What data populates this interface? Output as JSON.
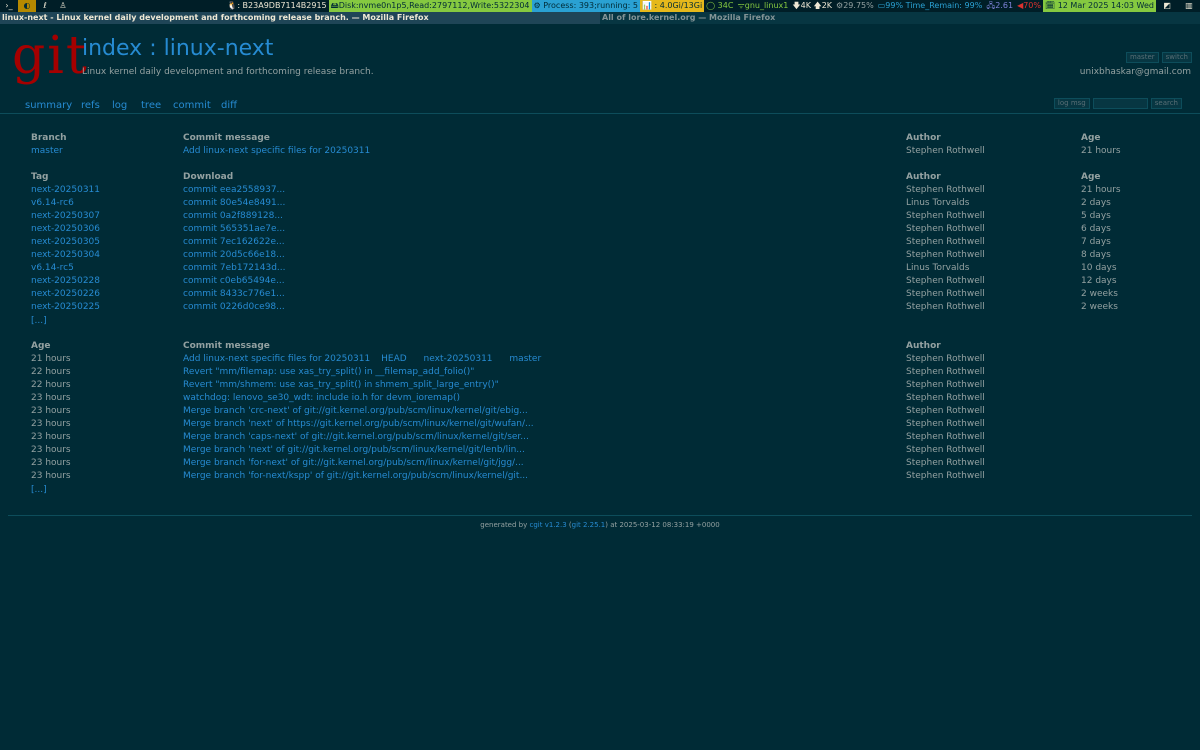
{
  "statusbar": {
    "workspaces": [
      "›_",
      "◐",
      "ℓ",
      "♙"
    ],
    "host": "🐧: B23A9DB7114B2915",
    "disk": "🖴Disk:nvme0n1p5,Read:2797112,Write:5322304",
    "process": "⚙ Process: 393;running: 5",
    "memory": "📊 : 4.0Gi/13Gi",
    "temp": "◯ 34C",
    "wifi": "ᯤgnu_linux1",
    "net": "🡇4K 🡅2K",
    "cpu": "⚙29.75%",
    "battery": "▭99% Time_Remain: 99%",
    "load": "🖧2.61",
    "volume": "◀70%",
    "date": "🗓 12 Mar 2025 14:03 Wed",
    "tray": [
      "◩",
      "▥"
    ]
  },
  "windows": {
    "active": "linux-next - Linux kernel daily development and forthcoming release branch. — Mozilla Firefox",
    "inactive": "All of lore.kernel.org — Mozilla Firefox"
  },
  "header": {
    "logo": "git",
    "index_link": "index",
    "separator": ":",
    "repo_link": "linux-next",
    "description": "Linux kernel daily development and forthcoming release branch.",
    "owner": "unixbhaskar@gmail.com",
    "branch_select": "master",
    "switch_button": "switch"
  },
  "tabs": [
    "summary",
    "refs",
    "log",
    "tree",
    "commit",
    "diff"
  ],
  "search": {
    "mode_select": "log msg",
    "button": "search"
  },
  "branches": {
    "headers": [
      "Branch",
      "Commit message",
      "Author",
      "Age"
    ],
    "rows": [
      {
        "name": "master",
        "message": "Add linux-next specific files for 20250311",
        "author": "Stephen Rothwell",
        "age": "21 hours"
      }
    ]
  },
  "tags": {
    "headers": [
      "Tag",
      "Download",
      "Author",
      "Age"
    ],
    "rows": [
      {
        "name": "next-20250311",
        "download": "commit eea2558937...",
        "author": "Stephen Rothwell",
        "age": "21 hours"
      },
      {
        "name": "v6.14-rc6",
        "download": "commit 80e54e8491...",
        "author": "Linus Torvalds",
        "age": "2 days"
      },
      {
        "name": "next-20250307",
        "download": "commit 0a2f889128...",
        "author": "Stephen Rothwell",
        "age": "5 days"
      },
      {
        "name": "next-20250306",
        "download": "commit 565351ae7e...",
        "author": "Stephen Rothwell",
        "age": "6 days"
      },
      {
        "name": "next-20250305",
        "download": "commit 7ec162622e...",
        "author": "Stephen Rothwell",
        "age": "7 days"
      },
      {
        "name": "next-20250304",
        "download": "commit 20d5c66e18...",
        "author": "Stephen Rothwell",
        "age": "8 days"
      },
      {
        "name": "v6.14-rc5",
        "download": "commit 7eb172143d...",
        "author": "Linus Torvalds",
        "age": "10 days"
      },
      {
        "name": "next-20250228",
        "download": "commit c0eb65494e...",
        "author": "Stephen Rothwell",
        "age": "12 days"
      },
      {
        "name": "next-20250226",
        "download": "commit 8433c776e1...",
        "author": "Stephen Rothwell",
        "age": "2 weeks"
      },
      {
        "name": "next-20250225",
        "download": "commit 0226d0ce98...",
        "author": "Stephen Rothwell",
        "age": "2 weeks"
      }
    ],
    "more": "[...]"
  },
  "log": {
    "headers": [
      "Age",
      "Commit message",
      "Author"
    ],
    "rows": [
      {
        "age": "21 hours",
        "message": "Add linux-next specific files for 20250311",
        "decorations": [
          "HEAD",
          "next-20250311",
          "master"
        ],
        "author": "Stephen Rothwell"
      },
      {
        "age": "22 hours",
        "message": "Revert \"mm/filemap: use xas_try_split() in __filemap_add_folio()\"",
        "decorations": [],
        "author": "Stephen Rothwell"
      },
      {
        "age": "22 hours",
        "message": "Revert \"mm/shmem: use xas_try_split() in shmem_split_large_entry()\"",
        "decorations": [],
        "author": "Stephen Rothwell"
      },
      {
        "age": "23 hours",
        "message": "watchdog: lenovo_se30_wdt: include io.h for devm_ioremap()",
        "decorations": [],
        "author": "Stephen Rothwell"
      },
      {
        "age": "23 hours",
        "message": "Merge branch 'crc-next' of git://git.kernel.org/pub/scm/linux/kernel/git/ebig...",
        "decorations": [],
        "author": "Stephen Rothwell"
      },
      {
        "age": "23 hours",
        "message": "Merge branch 'next' of https://git.kernel.org/pub/scm/linux/kernel/git/wufan/...",
        "decorations": [],
        "author": "Stephen Rothwell"
      },
      {
        "age": "23 hours",
        "message": "Merge branch 'caps-next' of git://git.kernel.org/pub/scm/linux/kernel/git/ser...",
        "decorations": [],
        "author": "Stephen Rothwell"
      },
      {
        "age": "23 hours",
        "message": "Merge branch 'next' of git://git.kernel.org/pub/scm/linux/kernel/git/lenb/lin...",
        "decorations": [],
        "author": "Stephen Rothwell"
      },
      {
        "age": "23 hours",
        "message": "Merge branch 'for-next' of git://git.kernel.org/pub/scm/linux/kernel/git/jgg/...",
        "decorations": [],
        "author": "Stephen Rothwell"
      },
      {
        "age": "23 hours",
        "message": "Merge branch 'for-next/kspp' of git://git.kernel.org/pub/scm/linux/kernel/git...",
        "decorations": [],
        "author": "Stephen Rothwell"
      }
    ],
    "more": "[...]"
  },
  "footer": {
    "prefix": "generated by",
    "cgit_link": "cgit v1.2.3",
    "open_paren": "(",
    "git_link": "git 2.25.1",
    "suffix": ") at 2025-03-12 08:33:19 +0000"
  },
  "colors": {
    "background": "#002b36",
    "link": "#268bd2",
    "text": "#93a1a1",
    "logo": "#a50000"
  }
}
